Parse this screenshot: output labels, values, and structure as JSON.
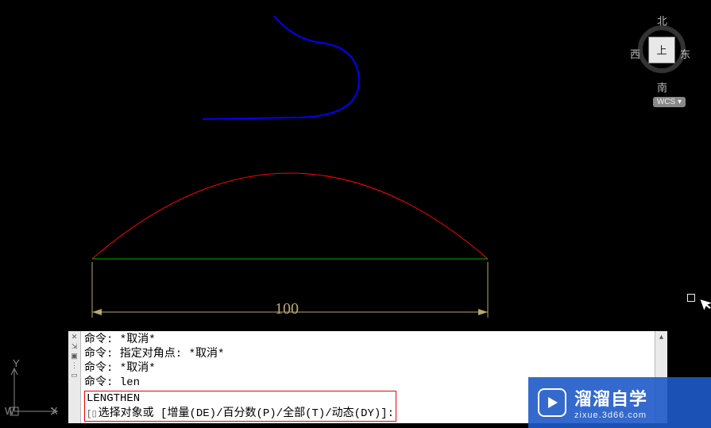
{
  "viewcube": {
    "north": "北",
    "south": "南",
    "west": "西",
    "east": "东",
    "top": "上"
  },
  "wcs_label": "WCS",
  "ucs": {
    "x": "X",
    "y": "Y",
    "w": "W"
  },
  "dimension": {
    "value": "100"
  },
  "command": {
    "lines": [
      "命令: *取消*",
      "命令: 指定对角点: *取消*",
      "命令: *取消*",
      "命令: len"
    ],
    "active_cmd": "LENGTHEN",
    "prompt": "选择对象或 [增量(DE)/百分数(P)/全部(T)/动态(DY)]:"
  },
  "watermark": {
    "title": "溜溜自学",
    "url": "zixue.3d66.com"
  },
  "colors": {
    "spline": "#0000ff",
    "arc": "#ff0000",
    "chord": "#00b000",
    "dim": "#b8a96f"
  }
}
